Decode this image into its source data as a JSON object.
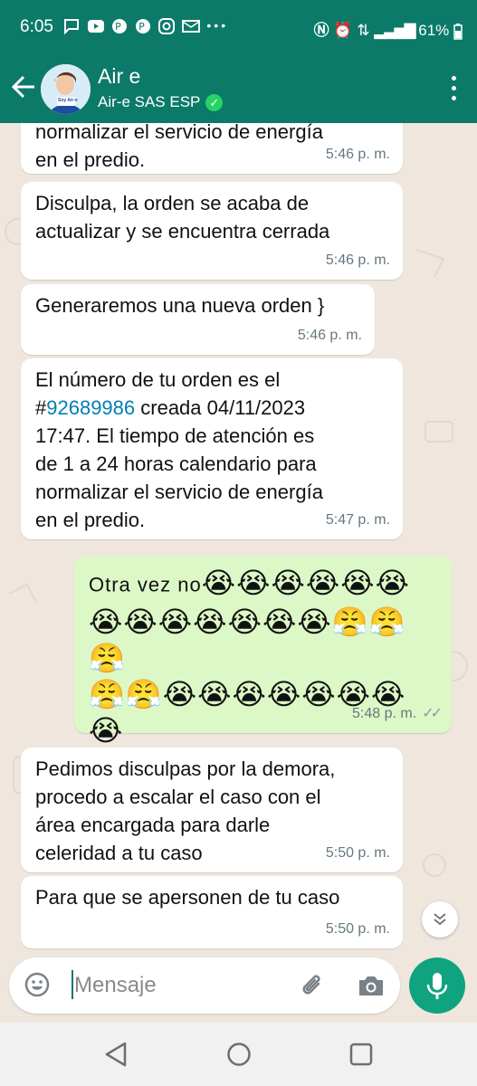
{
  "status_bar": {
    "time": "6:05",
    "notification_icons": [
      "message-icon",
      "youtube-icon",
      "pinterest-icon",
      "pinterest-icon",
      "instagram-icon",
      "email-icon",
      "more-icon"
    ],
    "battery": "61%"
  },
  "header": {
    "contact_name": "Air e",
    "contact_subtitle": "Air-e SAS ESP",
    "avatar_text": "Soy Air-e"
  },
  "messages": [
    {
      "direction": "in",
      "text": "normalizar el servicio de energía\nen el predio.",
      "time": "5:46 p. m."
    },
    {
      "direction": "in",
      "text": "Disculpa, la orden se acaba de\nactualizar y se encuentra cerrada",
      "time": "5:46 p. m."
    },
    {
      "direction": "in",
      "text": "Generaremos una nueva orden }",
      "time": "5:46 p. m."
    },
    {
      "direction": "in",
      "text_before": "El número de tu orden es el\n#",
      "link": "92689986",
      "text_after": " creada 04/11/2023\n17:47. El tiempo de atención es\nde 1 a 24 horas calendario para\nnormalizar el servicio de energía\nen el predio.",
      "time": "5:47 p. m."
    },
    {
      "direction": "out",
      "text": "Otra vez no",
      "emoji_rows": [
        "😭😭😭😭😭😭",
        "😭😭😭😭😭😭😭😤😤😤",
        "😤😤😭😭😭😭😭😭😭😭",
        "😭😭😭"
      ],
      "time": "5:48 p. m."
    },
    {
      "direction": "in",
      "text": "Pedimos disculpas por la demora,\nprocedo a escalar el caso con el\nárea encargada para darle\nceleridad a tu caso",
      "time": "5:50 p. m."
    },
    {
      "direction": "in",
      "text": "Para que se apersonen de tu caso",
      "time": "5:50 p. m."
    }
  ],
  "composer": {
    "placeholder": "Mensaje"
  }
}
